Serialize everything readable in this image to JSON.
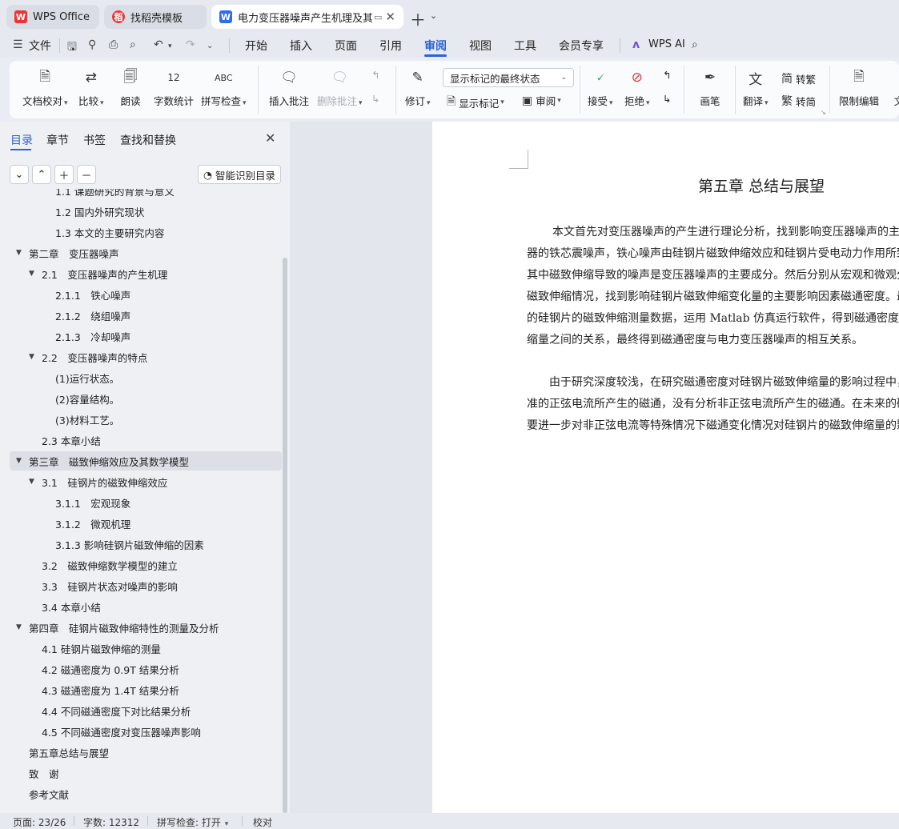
{
  "tabs": [
    {
      "label": "WPS Office",
      "icon": "wps-logo-icon"
    },
    {
      "label": "找稻壳模板",
      "icon": "docer-icon"
    },
    {
      "label": "电力变压器噪声产生机理及其影响因素研究",
      "icon": "writer-icon"
    }
  ],
  "menu": {
    "file": "文件",
    "items": [
      "开始",
      "插入",
      "页面",
      "引用",
      "审阅",
      "视图",
      "工具",
      "会员专享"
    ],
    "active": "审阅",
    "ai": "WPS AI"
  },
  "ribbon": {
    "doc_check": "文档校对",
    "compare": "比较",
    "read_aloud": "朗读",
    "word_count": "字数统计",
    "spell_check": "拼写检查",
    "insert_comment": "插入批注",
    "delete_comment": "删除批注",
    "track_changes": "修订",
    "markup_mode": "显示标记的最终状态",
    "show_markup": "显示标记",
    "review": "审阅",
    "accept": "接受",
    "reject": "拒绝",
    "pen": "画笔",
    "translate": "翻译",
    "to_traditional": "转繁",
    "to_simplified": "转简",
    "restrict_edit": "限制编辑",
    "doc_cut": "文"
  },
  "nav": {
    "tabs": [
      "目录",
      "章节",
      "书签",
      "查找和替换"
    ],
    "smart_toc": "智能识别目录",
    "toc": [
      {
        "text": "1.1 课题研究的背景与意义",
        "level": 2,
        "expand": ""
      },
      {
        "text": "1.2 国内外研究现状",
        "level": 2,
        "expand": ""
      },
      {
        "text": "1.3 本文的主要研究内容",
        "level": 2,
        "expand": ""
      },
      {
        "text": "第二章　变压器噪声",
        "level": 0,
        "expand": "▼"
      },
      {
        "text": "2.1　变压器噪声的产生机理",
        "level": 1,
        "expand": "▼"
      },
      {
        "text": "2.1.1　铁心噪声",
        "level": 2,
        "expand": ""
      },
      {
        "text": "2.1.2　绕组噪声",
        "level": 2,
        "expand": ""
      },
      {
        "text": "2.1.3　冷却噪声",
        "level": 2,
        "expand": ""
      },
      {
        "text": "2.2　变压器噪声的特点",
        "level": 1,
        "expand": "▼"
      },
      {
        "text": "(1)运行状态。",
        "level": 2,
        "expand": ""
      },
      {
        "text": "(2)容量结构。",
        "level": 2,
        "expand": ""
      },
      {
        "text": "(3)材料工艺。",
        "level": 2,
        "expand": ""
      },
      {
        "text": "2.3 本章小结",
        "level": 1,
        "expand": ""
      },
      {
        "text": "第三章　磁致伸缩效应及其数学模型",
        "level": 0,
        "expand": "▼"
      },
      {
        "text": "3.1　硅钢片的磁致伸缩效应",
        "level": 1,
        "expand": "▼"
      },
      {
        "text": "3.1.1　宏观现象",
        "level": 2,
        "expand": ""
      },
      {
        "text": "3.1.2　微观机理",
        "level": 2,
        "expand": ""
      },
      {
        "text": "3.1.3 影响硅钢片磁致伸缩的因素",
        "level": 2,
        "expand": ""
      },
      {
        "text": "3.2　磁致伸缩数学模型的建立",
        "level": 1,
        "expand": ""
      },
      {
        "text": "3.3　硅钢片状态对噪声的影响",
        "level": 1,
        "expand": ""
      },
      {
        "text": "3.4  本章小结",
        "level": 1,
        "expand": ""
      },
      {
        "text": "第四章　硅钢片磁致伸缩特性的测量及分析",
        "level": 0,
        "expand": "▼"
      },
      {
        "text": "4.1  硅钢片磁致伸缩的测量",
        "level": 1,
        "expand": ""
      },
      {
        "text": "4.2  磁通密度为 0.9T 结果分析",
        "level": 1,
        "expand": ""
      },
      {
        "text": "4.3  磁通密度为 1.4T 结果分析",
        "level": 1,
        "expand": ""
      },
      {
        "text": "4.4  不同磁通密度下对比结果分析",
        "level": 1,
        "expand": ""
      },
      {
        "text": "4.5  不同磁通密度对变压器噪声影响",
        "level": 1,
        "expand": ""
      },
      {
        "text": "第五章总结与展望",
        "level": 0,
        "expand": ""
      },
      {
        "text": "致　谢",
        "level": 0,
        "expand": ""
      },
      {
        "text": "参考文献",
        "level": 0,
        "expand": ""
      }
    ],
    "selected_index": 13
  },
  "document": {
    "heading": "第五章  总结与展望",
    "paragraphs": [
      "本文首先对变压器噪声的产生进行理论分析，找到影响变压器噪声的主",
      "器的铁芯震噪声，铁心噪声由硅钢片磁致伸缩效应和硅钢片受电动力作用所致",
      "其中磁致伸缩导致的噪声是变压器噪声的主要成分。然后分别从宏观和微观分",
      "磁致伸缩情况，找到影响硅钢片磁致伸缩变化量的主要影响因素磁通密度。最",
      "的硅钢片的磁致伸缩测量数据，运用 Matlab 仿真运行软件，得到磁通密度与",
      "缩量之间的关系，最终得到磁通密度与电力变压器噪声的相互关系。",
      "由于研究深度较浅，在研究磁通密度对硅钢片磁致伸缩量的影响过程中，",
      "准的正弦电流所产生的磁通，没有分析非正弦电流所产生的磁通。在未来的研",
      "要进一步对非正弦电流等特殊情况下磁通变化情况对硅钢片的磁致伸缩量的影"
    ]
  },
  "status": {
    "page": "页面: 23/26",
    "words": "字数: 12312",
    "spell": "拼写检查: 打开",
    "proof": "校对"
  }
}
